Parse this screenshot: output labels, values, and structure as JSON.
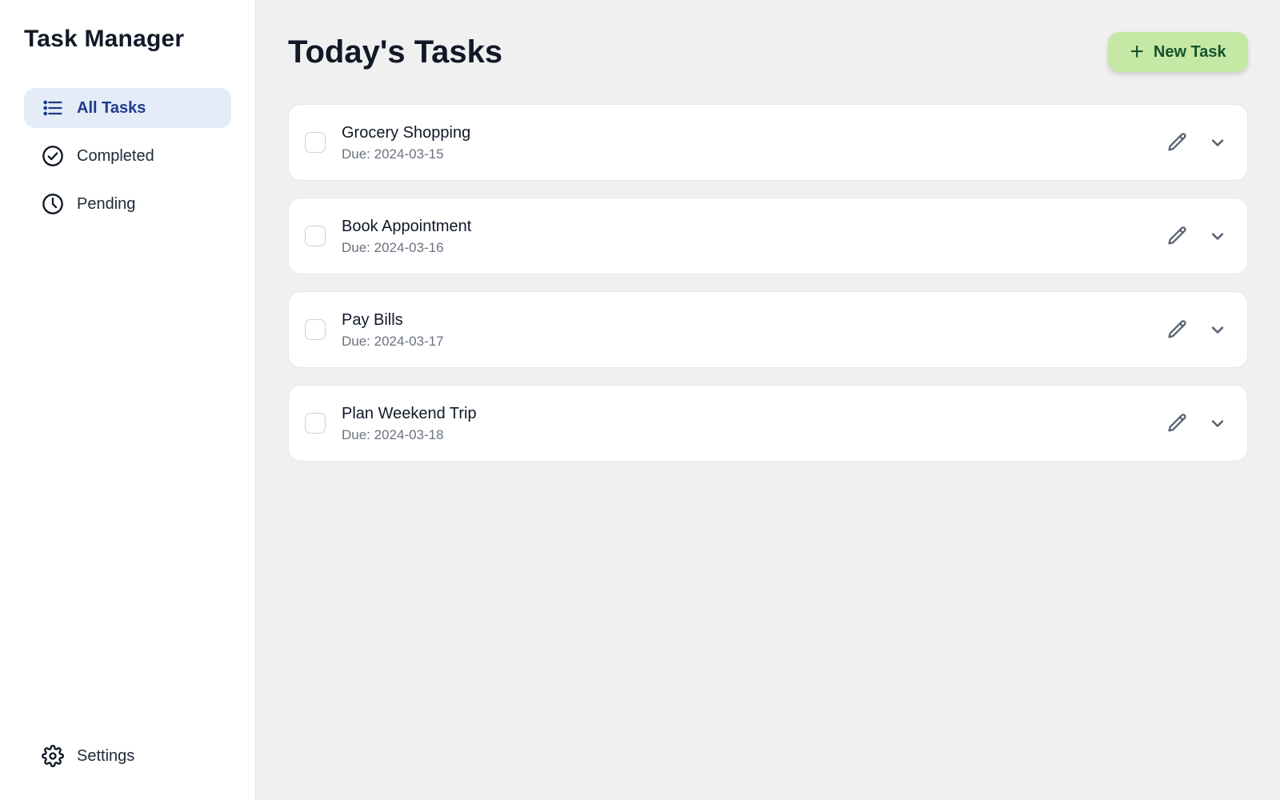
{
  "sidebar": {
    "title": "Task Manager",
    "items": [
      {
        "label": "All Tasks",
        "icon": "list-icon",
        "active": true
      },
      {
        "label": "Completed",
        "icon": "check-circle-icon",
        "active": false
      },
      {
        "label": "Pending",
        "icon": "clock-icon",
        "active": false
      }
    ],
    "settings": {
      "label": "Settings",
      "icon": "gear-icon"
    }
  },
  "main": {
    "title": "Today's Tasks",
    "new_task_label": "New Task",
    "tasks": [
      {
        "name": "Grocery Shopping",
        "due": "Due: 2024-03-15"
      },
      {
        "name": "Book Appointment",
        "due": "Due: 2024-03-16"
      },
      {
        "name": "Pay Bills",
        "due": "Due: 2024-03-17"
      },
      {
        "name": "Plan Weekend Trip",
        "due": "Due: 2024-03-18"
      }
    ]
  },
  "colors": {
    "accent_active_bg": "#e3ecf7",
    "accent_active_text": "#1e3a8a",
    "new_task_bg": "#c5e8a4",
    "new_task_text": "#14532d"
  }
}
